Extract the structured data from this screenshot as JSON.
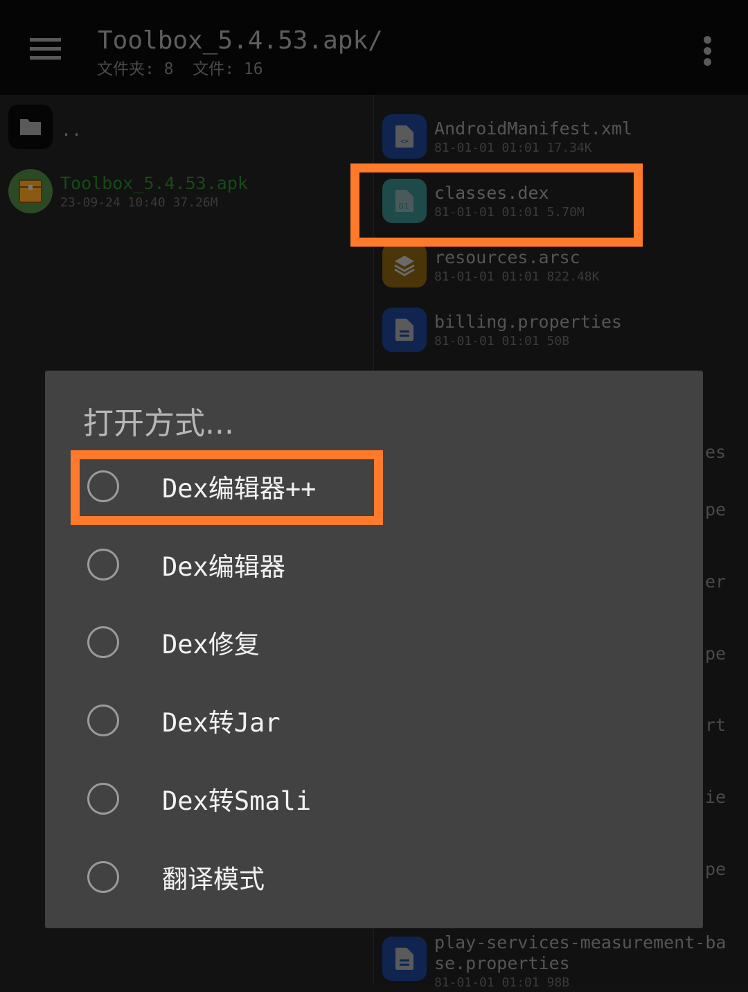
{
  "header": {
    "title": "Toolbox_5.4.53.apk/",
    "subtitle": "文件夹: 8  文件: 16"
  },
  "left_pane": {
    "parent": {
      "name": ".."
    },
    "apk": {
      "name": "Toolbox_5.4.53.apk",
      "meta": "23-09-24 10:40 37.26M"
    }
  },
  "right_pane": {
    "files": [
      {
        "name": "AndroidManifest.xml",
        "meta": "81-01-01 01:01 17.34K",
        "icon": "code-file-icon",
        "color": "#0f2550"
      },
      {
        "name": "classes.dex",
        "meta": "81-01-01 01:01 5.70M",
        "icon": "binary-file-icon",
        "color": "#1f4a4a"
      },
      {
        "name": "resources.arsc",
        "meta": "81-01-01 01:01 822.48K",
        "icon": "layers-icon",
        "color": "#4a3508"
      },
      {
        "name": "billing.properties",
        "meta": "81-01-01 01:01 50B",
        "icon": "text-file-icon",
        "color": "#0f2550"
      },
      {
        "name": "play-services-measurement-ba\nse.properties",
        "meta": "81-01-01 01:01 98B",
        "icon": "text-file-icon",
        "color": "#0f2550"
      }
    ],
    "partial_fragments": [
      "es",
      "pe",
      "er",
      "pe",
      "rt",
      "ie",
      "pe"
    ]
  },
  "dialog": {
    "title": "打开方式...",
    "options": [
      "Dex编辑器++",
      "Dex编辑器",
      "Dex修复",
      "Dex转Jar",
      "Dex转Smali",
      "翻译模式"
    ]
  },
  "colors": {
    "highlight": "#ff7a2a",
    "dialog_bg": "#424242"
  }
}
